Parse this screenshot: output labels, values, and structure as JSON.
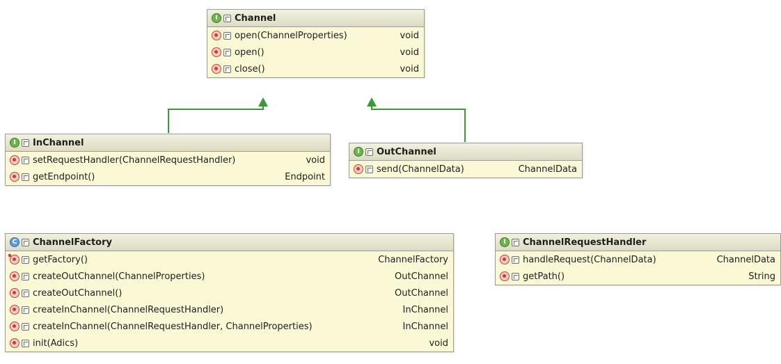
{
  "colors": {
    "box_fill": "#fbf8d6",
    "box_border": "#9a9a9a",
    "header_fill": "#e6e4cc",
    "edge": "#3a9a3a",
    "interface_icon": "#6fb54e",
    "class_icon": "#5d9ed8",
    "method_icon": "#c9402e"
  },
  "icons": {
    "interface": "interface-icon",
    "class": "class-icon",
    "method": "method-icon",
    "static_method": "static-method-icon",
    "visibility": "public-visibility-icon"
  },
  "classes": [
    {
      "id": "channel",
      "name": "Channel",
      "kind": "interface",
      "kind_letter": "I",
      "members": [
        {
          "signature": "open(ChannelProperties)",
          "returns": "void",
          "static": false
        },
        {
          "signature": "open()",
          "returns": "void",
          "static": false
        },
        {
          "signature": "close()",
          "returns": "void",
          "static": false
        }
      ]
    },
    {
      "id": "in-channel",
      "name": "InChannel",
      "kind": "interface",
      "kind_letter": "I",
      "members": [
        {
          "signature": "setRequestHandler(ChannelRequestHandler)",
          "returns": "void",
          "static": false
        },
        {
          "signature": "getEndpoint()",
          "returns": "Endpoint",
          "static": false
        }
      ]
    },
    {
      "id": "out-channel",
      "name": "OutChannel",
      "kind": "interface",
      "kind_letter": "I",
      "members": [
        {
          "signature": "send(ChannelData)",
          "returns": "ChannelData",
          "static": false
        }
      ]
    },
    {
      "id": "channel-factory",
      "name": "ChannelFactory",
      "kind": "class",
      "kind_letter": "C",
      "members": [
        {
          "signature": "getFactory()",
          "returns": "ChannelFactory",
          "static": true
        },
        {
          "signature": "createOutChannel(ChannelProperties)",
          "returns": "OutChannel",
          "static": false
        },
        {
          "signature": "createOutChannel()",
          "returns": "OutChannel",
          "static": false
        },
        {
          "signature": "createInChannel(ChannelRequestHandler)",
          "returns": "InChannel",
          "static": false
        },
        {
          "signature": "createInChannel(ChannelRequestHandler, ChannelProperties)",
          "returns": "InChannel",
          "static": false
        },
        {
          "signature": "init(Adics)",
          "returns": "void",
          "static": false
        }
      ]
    },
    {
      "id": "channel-request-handler",
      "name": "ChannelRequestHandler",
      "kind": "interface",
      "kind_letter": "I",
      "members": [
        {
          "signature": "handleRequest(ChannelData)",
          "returns": "ChannelData",
          "static": false
        },
        {
          "signature": "getPath()",
          "returns": "String",
          "static": false
        }
      ]
    }
  ],
  "relations": [
    {
      "from": "in-channel",
      "to": "channel",
      "type": "extends"
    },
    {
      "from": "out-channel",
      "to": "channel",
      "type": "extends"
    }
  ]
}
